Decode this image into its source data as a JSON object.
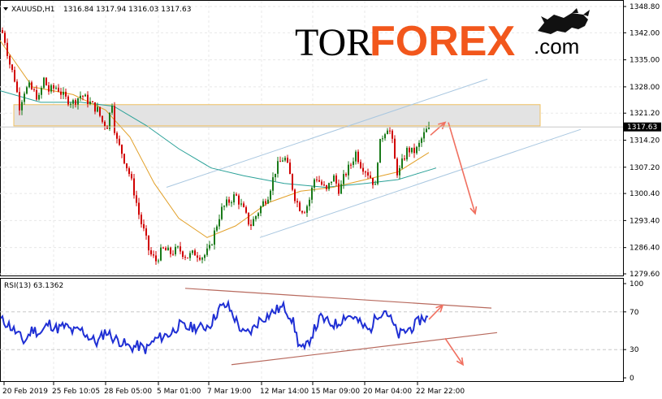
{
  "header": {
    "symbol": "XAUUSD,H1",
    "ohlc": "1316.84 1317.94 1316.03 1317.63"
  },
  "logo": {
    "part1": "TOR",
    "part2": "FOREX",
    "part3": ".com"
  },
  "colors": {
    "bull": "#1a7a1a",
    "bear": "#d00000",
    "ma_fast": "#e2a029",
    "ma_slow": "#2aa198",
    "channel": "#a9c7e0",
    "zone_fill": "#e3e3e3",
    "zone_border": "#f0c060",
    "arrow": "#f07060",
    "rsi_line": "#1f2fd4",
    "rsi_trend": "#b86a5e",
    "price_tag_bg": "#000000",
    "price_tag_fg": "#ffffff"
  },
  "price_axis": {
    "labels": [
      "1348.80",
      "1342.00",
      "1335.00",
      "1328.00",
      "1321.20",
      "1314.20",
      "1307.20",
      "1300.40",
      "1293.40",
      "1286.40",
      "1279.60"
    ],
    "current": "1317.63"
  },
  "rsi": {
    "title": "RSI(13) 63.1362",
    "axis_labels": [
      "100",
      "70",
      "30",
      "0"
    ]
  },
  "time_axis": [
    "20 Feb 2019",
    "25 Feb 10:05",
    "28 Feb 05:00",
    "5 Mar 01:00",
    "7 Mar 19:00",
    "12 Mar 14:00",
    "15 Mar 09:00",
    "20 Mar 04:00",
    "22 Mar 22:00"
  ],
  "chart_data": {
    "type": "candlestick",
    "symbol": "XAUUSD",
    "timeframe": "H1",
    "ylim": [
      1279.6,
      1348.8
    ],
    "price_path": [
      [
        0,
        1344
      ],
      [
        6,
        1340
      ],
      [
        12,
        1334
      ],
      [
        18,
        1330
      ],
      [
        24,
        1323
      ],
      [
        30,
        1327
      ],
      [
        36,
        1328
      ],
      [
        48,
        1325
      ],
      [
        54,
        1330
      ],
      [
        60,
        1327
      ],
      [
        70,
        1328
      ],
      [
        80,
        1325
      ],
      [
        90,
        1324
      ],
      [
        100,
        1326
      ],
      [
        110,
        1324
      ],
      [
        120,
        1322
      ],
      [
        126,
        1319
      ],
      [
        132,
        1318
      ],
      [
        138,
        1324
      ],
      [
        142,
        1315
      ],
      [
        150,
        1311
      ],
      [
        160,
        1305
      ],
      [
        166,
        1300
      ],
      [
        172,
        1294
      ],
      [
        178,
        1290
      ],
      [
        184,
        1285
      ],
      [
        192,
        1283
      ],
      [
        200,
        1286
      ],
      [
        210,
        1285
      ],
      [
        220,
        1286
      ],
      [
        230,
        1284
      ],
      [
        240,
        1285
      ],
      [
        250,
        1284
      ],
      [
        258,
        1286
      ],
      [
        265,
        1291
      ],
      [
        272,
        1296
      ],
      [
        280,
        1298
      ],
      [
        290,
        1300
      ],
      [
        300,
        1296
      ],
      [
        308,
        1292
      ],
      [
        316,
        1295
      ],
      [
        324,
        1298
      ],
      [
        330,
        1300
      ],
      [
        340,
        1307
      ],
      [
        350,
        1310
      ],
      [
        356,
        1306
      ],
      [
        362,
        1300
      ],
      [
        368,
        1297
      ],
      [
        374,
        1296
      ],
      [
        380,
        1298
      ],
      [
        388,
        1305
      ],
      [
        395,
        1303
      ],
      [
        402,
        1301
      ],
      [
        410,
        1305
      ],
      [
        418,
        1301
      ],
      [
        424,
        1305
      ],
      [
        432,
        1308
      ],
      [
        438,
        1311
      ],
      [
        444,
        1308
      ],
      [
        452,
        1306
      ],
      [
        458,
        1304
      ],
      [
        462,
        1302
      ],
      [
        466,
        1312
      ],
      [
        472,
        1316
      ],
      [
        478,
        1318
      ],
      [
        482,
        1315
      ],
      [
        486,
        1309
      ],
      [
        490,
        1305
      ],
      [
        496,
        1309
      ],
      [
        502,
        1312
      ],
      [
        508,
        1311
      ],
      [
        514,
        1312
      ],
      [
        520,
        1315
      ],
      [
        526,
        1317
      ]
    ],
    "ma_fast": [
      [
        0,
        1340
      ],
      [
        40,
        1328
      ],
      [
        90,
        1326
      ],
      [
        130,
        1322
      ],
      [
        160,
        1315
      ],
      [
        190,
        1303
      ],
      [
        220,
        1294
      ],
      [
        255,
        1289
      ],
      [
        290,
        1292
      ],
      [
        330,
        1298
      ],
      [
        370,
        1301
      ],
      [
        410,
        1302
      ],
      [
        450,
        1304
      ],
      [
        490,
        1306
      ],
      [
        528,
        1311
      ]
    ],
    "ma_slow": [
      [
        0,
        1327
      ],
      [
        50,
        1324
      ],
      [
        100,
        1324
      ],
      [
        140,
        1323
      ],
      [
        180,
        1318
      ],
      [
        220,
        1312
      ],
      [
        260,
        1307
      ],
      [
        300,
        1305
      ],
      [
        350,
        1303
      ],
      [
        400,
        1302
      ],
      [
        450,
        1303
      ],
      [
        490,
        1304
      ],
      [
        537,
        1307
      ]
    ],
    "resistance_zone": {
      "from": 1317.9,
      "to": 1323.4
    },
    "channel_lines": [
      {
        "p1": [
          205,
          1302
        ],
        "p2": [
          600,
          1330
        ]
      },
      {
        "p1": [
          320,
          1289
        ],
        "p2": [
          715,
          1317
        ]
      }
    ],
    "forecast_arrows": [
      {
        "from": [
          530,
          1315.5
        ],
        "to": [
          548,
          1318.8
        ]
      },
      {
        "from": [
          552,
          1318.8
        ],
        "to": [
          585,
          1295.2
        ]
      }
    ],
    "rsi": {
      "period": 13,
      "last": 63.1362,
      "levels": [
        70,
        30
      ],
      "ylim": [
        0,
        100
      ],
      "values": [
        [
          0,
          62
        ],
        [
          10,
          57
        ],
        [
          20,
          48
        ],
        [
          30,
          38
        ],
        [
          40,
          52
        ],
        [
          50,
          47
        ],
        [
          60,
          58
        ],
        [
          70,
          52
        ],
        [
          80,
          55
        ],
        [
          90,
          49
        ],
        [
          100,
          51
        ],
        [
          110,
          43
        ],
        [
          120,
          37
        ],
        [
          130,
          50
        ],
        [
          140,
          42
        ],
        [
          150,
          38
        ],
        [
          160,
          32
        ],
        [
          170,
          34
        ],
        [
          180,
          30
        ],
        [
          190,
          40
        ],
        [
          200,
          44
        ],
        [
          210,
          47
        ],
        [
          220,
          56
        ],
        [
          230,
          53
        ],
        [
          240,
          54
        ],
        [
          250,
          53
        ],
        [
          260,
          58
        ],
        [
          270,
          74
        ],
        [
          280,
          77
        ],
        [
          290,
          62
        ],
        [
          300,
          46
        ],
        [
          310,
          50
        ],
        [
          320,
          62
        ],
        [
          330,
          66
        ],
        [
          340,
          72
        ],
        [
          350,
          75
        ],
        [
          360,
          62
        ],
        [
          368,
          35
        ],
        [
          375,
          29
        ],
        [
          385,
          48
        ],
        [
          395,
          64
        ],
        [
          405,
          58
        ],
        [
          415,
          57
        ],
        [
          425,
          66
        ],
        [
          435,
          65
        ],
        [
          445,
          56
        ],
        [
          455,
          50
        ],
        [
          465,
          68
        ],
        [
          475,
          72
        ],
        [
          485,
          55
        ],
        [
          490,
          45
        ],
        [
          500,
          50
        ],
        [
          510,
          55
        ],
        [
          520,
          64
        ],
        [
          527,
          63
        ]
      ],
      "trend_lines": [
        {
          "p1": [
            228,
            95
          ],
          "p2": [
            605,
            74
          ]
        },
        {
          "p1": [
            285,
            14
          ],
          "p2": [
            612,
            48
          ]
        }
      ],
      "forecast_arrows": [
        {
          "from": [
            528,
            62
          ],
          "to": [
            545,
            77
          ]
        },
        {
          "from": [
            548,
            42
          ],
          "to": [
            570,
            14
          ]
        }
      ]
    }
  }
}
